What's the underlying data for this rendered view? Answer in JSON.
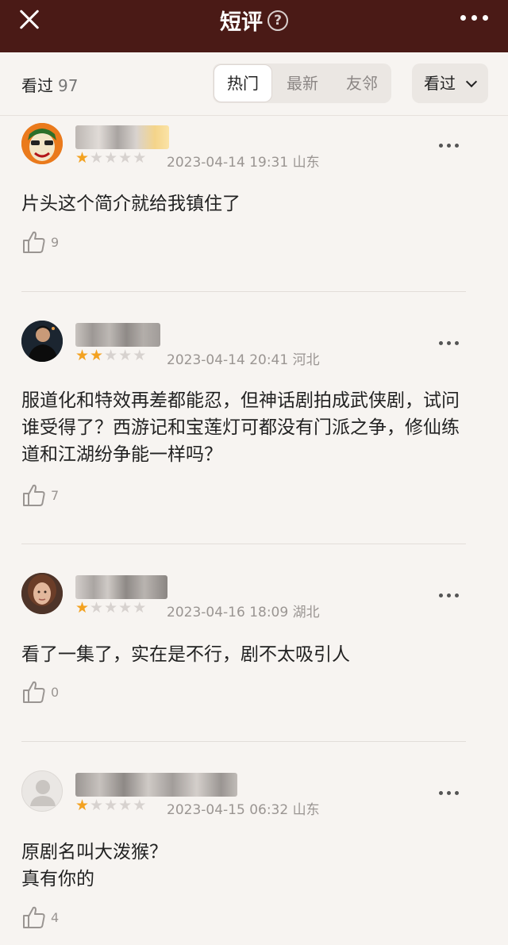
{
  "header": {
    "title": "短评",
    "help_icon": "question-circle-icon",
    "close_icon": "close-icon",
    "more_icon": "more-horizontal-icon",
    "background": "#4a1a16"
  },
  "filter": {
    "count_label": "看过",
    "count_value": "97",
    "tabs": [
      {
        "label": "热门",
        "active": true
      },
      {
        "label": "最新",
        "active": false
      },
      {
        "label": "友邻",
        "active": false
      }
    ],
    "dropdown_label": "看过"
  },
  "comments": [
    {
      "rating": 1,
      "date": "2023-04-14 19:31",
      "location": "山东",
      "text": "片头这个简介就给我镇住了",
      "likes": "9"
    },
    {
      "rating": 2,
      "date": "2023-04-14 20:41",
      "location": "河北",
      "text": "服道化和特效再差都能忍，但神话剧拍成武侠剧，试问谁受得了？西游记和宝莲灯可都没有门派之争，修仙练道和江湖纷争能一样吗？",
      "likes": "7"
    },
    {
      "rating": 1,
      "date": "2023-04-16 18:09",
      "location": "湖北",
      "text": "看了一集了，实在是不行，剧不太吸引人",
      "likes": "0"
    },
    {
      "rating": 1,
      "date": "2023-04-15 06:32",
      "location": "山东",
      "text": "原剧名叫大泼猴？\n真有你的",
      "likes": "4"
    }
  ],
  "colors": {
    "star_on": "#f3a221",
    "star_off": "#d7d2cf",
    "meta": "#9a9592"
  }
}
